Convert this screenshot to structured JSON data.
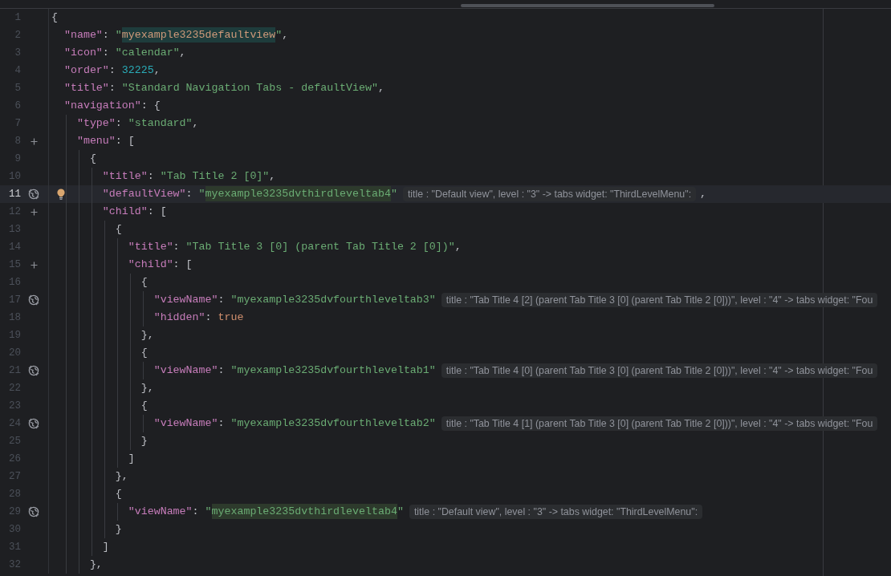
{
  "editor": {
    "lines": [
      {
        "number": "1",
        "bulb": false,
        "current": false,
        "tokens": [
          {
            "kind": "p",
            "text": "{"
          }
        ]
      },
      {
        "number": "2",
        "bulb": false,
        "current": false,
        "tokens": [
          {
            "kind": "key",
            "text": "  \"name\""
          },
          {
            "kind": "p",
            "text": ": "
          },
          {
            "kind": "str",
            "text": "\""
          },
          {
            "kind": "identifier",
            "text": "myexample3235defaultview"
          },
          {
            "kind": "str",
            "text": "\""
          },
          {
            "kind": "p",
            "text": ","
          }
        ]
      },
      {
        "number": "3",
        "bulb": false,
        "current": false,
        "tokens": [
          {
            "kind": "key",
            "text": "  \"icon\""
          },
          {
            "kind": "p",
            "text": ": "
          },
          {
            "kind": "str",
            "text": "\"calendar\""
          },
          {
            "kind": "p",
            "text": ","
          }
        ]
      },
      {
        "number": "4",
        "bulb": false,
        "current": false,
        "tokens": [
          {
            "kind": "key",
            "text": "  \"order\""
          },
          {
            "kind": "p",
            "text": ": "
          },
          {
            "kind": "num",
            "text": "32225"
          },
          {
            "kind": "p",
            "text": ","
          }
        ]
      },
      {
        "number": "5",
        "bulb": false,
        "current": false,
        "tokens": [
          {
            "kind": "key",
            "text": "  \"title\""
          },
          {
            "kind": "p",
            "text": ": "
          },
          {
            "kind": "str",
            "text": "\"Standard Navigation Tabs - defaultView\""
          },
          {
            "kind": "p",
            "text": ","
          }
        ]
      },
      {
        "number": "6",
        "bulb": false,
        "current": false,
        "tokens": [
          {
            "kind": "key",
            "text": "  \"navigation\""
          },
          {
            "kind": "p",
            "text": ": {"
          }
        ]
      },
      {
        "number": "7",
        "bulb": false,
        "current": false,
        "tokens": [
          {
            "kind": "key",
            "text": "    \"type\""
          },
          {
            "kind": "p",
            "text": ": "
          },
          {
            "kind": "str",
            "text": "\"standard\""
          },
          {
            "kind": "p",
            "text": ","
          }
        ]
      },
      {
        "number": "8",
        "gutter": {
          "kind": "plus"
        },
        "bulb": false,
        "current": false,
        "tokens": [
          {
            "kind": "key",
            "text": "    \"menu\""
          },
          {
            "kind": "p",
            "text": ": ["
          }
        ]
      },
      {
        "number": "9",
        "bulb": false,
        "current": false,
        "tokens": [
          {
            "kind": "p",
            "text": "      {"
          }
        ]
      },
      {
        "number": "10",
        "bulb": false,
        "current": false,
        "tokens": [
          {
            "kind": "key",
            "text": "        \"title\""
          },
          {
            "kind": "p",
            "text": ": "
          },
          {
            "kind": "str",
            "text": "\"Tab Title 2 [0]\""
          },
          {
            "kind": "p",
            "text": ","
          }
        ]
      },
      {
        "number": "11",
        "gutter": {
          "kind": "reference"
        },
        "bulb": true,
        "current": true,
        "tokens": [
          {
            "kind": "key",
            "text": "        \"defaultView\""
          },
          {
            "kind": "p",
            "text": ": "
          },
          {
            "kind": "str",
            "text": "\""
          },
          {
            "kind": "reference",
            "text": "myexample3235dvthirdleveltab4"
          },
          {
            "kind": "str",
            "text": "\""
          }
        ],
        "hint": "title : \"Default view\", level : \"3\" -> tabs widget: \"ThirdLevelMenu\":",
        "after": ","
      },
      {
        "number": "12",
        "gutter": {
          "kind": "plus"
        },
        "bulb": false,
        "current": false,
        "tokens": [
          {
            "kind": "key",
            "text": "        \"child\""
          },
          {
            "kind": "p",
            "text": ": ["
          }
        ]
      },
      {
        "number": "13",
        "bulb": false,
        "current": false,
        "tokens": [
          {
            "kind": "p",
            "text": "          {"
          }
        ]
      },
      {
        "number": "14",
        "bulb": false,
        "current": false,
        "tokens": [
          {
            "kind": "key",
            "text": "            \"title\""
          },
          {
            "kind": "p",
            "text": ": "
          },
          {
            "kind": "str",
            "text": "\"Tab Title 3 [0] (parent Tab Title 2 [0])\""
          },
          {
            "kind": "p",
            "text": ","
          }
        ]
      },
      {
        "number": "15",
        "gutter": {
          "kind": "plus"
        },
        "bulb": false,
        "current": false,
        "tokens": [
          {
            "kind": "key",
            "text": "            \"child\""
          },
          {
            "kind": "p",
            "text": ": ["
          }
        ]
      },
      {
        "number": "16",
        "bulb": false,
        "current": false,
        "tokens": [
          {
            "kind": "p",
            "text": "              {"
          }
        ]
      },
      {
        "number": "17",
        "gutter": {
          "kind": "reference"
        },
        "bulb": false,
        "current": false,
        "tokens": [
          {
            "kind": "key",
            "text": "                \"viewName\""
          },
          {
            "kind": "p",
            "text": ": "
          },
          {
            "kind": "str",
            "text": "\"myexample3235dvfourthleveltab3\""
          }
        ],
        "hint": "title : \"Tab Title 4 [2] (parent Tab Title 3 [0] (parent Tab Title 2 [0]))\", level : \"4\" -> tabs widget: \"Fou"
      },
      {
        "number": "18",
        "bulb": false,
        "current": false,
        "tokens": [
          {
            "kind": "key",
            "text": "                \"hidden\""
          },
          {
            "kind": "p",
            "text": ": "
          },
          {
            "kind": "bool",
            "text": "true"
          }
        ]
      },
      {
        "number": "19",
        "bulb": false,
        "current": false,
        "tokens": [
          {
            "kind": "p",
            "text": "              },"
          }
        ]
      },
      {
        "number": "20",
        "bulb": false,
        "current": false,
        "tokens": [
          {
            "kind": "p",
            "text": "              {"
          }
        ]
      },
      {
        "number": "21",
        "gutter": {
          "kind": "reference"
        },
        "bulb": false,
        "current": false,
        "tokens": [
          {
            "kind": "key",
            "text": "                \"viewName\""
          },
          {
            "kind": "p",
            "text": ": "
          },
          {
            "kind": "str",
            "text": "\"myexample3235dvfourthleveltab1\""
          }
        ],
        "hint": "title : \"Tab Title 4 [0] (parent Tab Title 3 [0] (parent Tab Title 2 [0]))\", level : \"4\" -> tabs widget: \"Fou"
      },
      {
        "number": "22",
        "bulb": false,
        "current": false,
        "tokens": [
          {
            "kind": "p",
            "text": "              },"
          }
        ]
      },
      {
        "number": "23",
        "bulb": false,
        "current": false,
        "tokens": [
          {
            "kind": "p",
            "text": "              {"
          }
        ]
      },
      {
        "number": "24",
        "gutter": {
          "kind": "reference"
        },
        "bulb": false,
        "current": false,
        "tokens": [
          {
            "kind": "key",
            "text": "                \"viewName\""
          },
          {
            "kind": "p",
            "text": ": "
          },
          {
            "kind": "str",
            "text": "\"myexample3235dvfourthleveltab2\""
          }
        ],
        "hint": "title : \"Tab Title 4 [1] (parent Tab Title 3 [0] (parent Tab Title 2 [0]))\", level : \"4\" -> tabs widget: \"Fou"
      },
      {
        "number": "25",
        "bulb": false,
        "current": false,
        "tokens": [
          {
            "kind": "p",
            "text": "              }"
          }
        ]
      },
      {
        "number": "26",
        "bulb": false,
        "current": false,
        "tokens": [
          {
            "kind": "p",
            "text": "            ]"
          }
        ]
      },
      {
        "number": "27",
        "bulb": false,
        "current": false,
        "tokens": [
          {
            "kind": "p",
            "text": "          },"
          }
        ]
      },
      {
        "number": "28",
        "bulb": false,
        "current": false,
        "tokens": [
          {
            "kind": "p",
            "text": "          {"
          }
        ]
      },
      {
        "number": "29",
        "gutter": {
          "kind": "reference"
        },
        "bulb": false,
        "current": false,
        "tokens": [
          {
            "kind": "key",
            "text": "            \"viewName\""
          },
          {
            "kind": "p",
            "text": ": "
          },
          {
            "kind": "str",
            "text": "\""
          },
          {
            "kind": "reference",
            "text": "myexample3235dvthirdleveltab4"
          },
          {
            "kind": "str",
            "text": "\""
          }
        ],
        "hint": "title : \"Default view\", level : \"3\" -> tabs widget: \"ThirdLevelMenu\":"
      },
      {
        "number": "30",
        "bulb": false,
        "current": false,
        "tokens": [
          {
            "kind": "p",
            "text": "          }"
          }
        ]
      },
      {
        "number": "31",
        "bulb": false,
        "current": false,
        "tokens": [
          {
            "kind": "p",
            "text": "        ]"
          }
        ]
      },
      {
        "number": "32",
        "bulb": false,
        "current": false,
        "tokens": [
          {
            "kind": "p",
            "text": "      },"
          }
        ]
      }
    ]
  }
}
